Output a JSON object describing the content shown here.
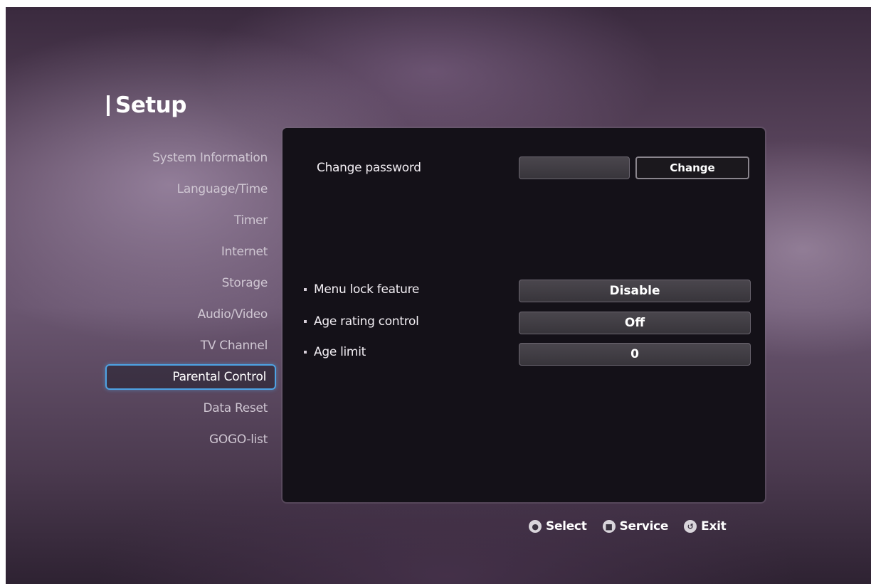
{
  "header": {
    "title": "Setup"
  },
  "sidebar": {
    "items": [
      {
        "label": "System Information",
        "selected": false
      },
      {
        "label": "Language/Time",
        "selected": false
      },
      {
        "label": "Timer",
        "selected": false
      },
      {
        "label": "Internet",
        "selected": false
      },
      {
        "label": "Storage",
        "selected": false
      },
      {
        "label": "Audio/Video",
        "selected": false
      },
      {
        "label": "TV Channel",
        "selected": false
      },
      {
        "label": "Parental Control",
        "selected": true
      },
      {
        "label": "Data Reset",
        "selected": false
      },
      {
        "label": "GOGO-list",
        "selected": false
      }
    ]
  },
  "panel": {
    "password": {
      "label": "Change password",
      "value": "",
      "button_label": "Change"
    },
    "settings": [
      {
        "label": "Menu lock feature",
        "value": "Disable"
      },
      {
        "label": "Age rating control",
        "value": "Off"
      },
      {
        "label": "Age limit",
        "value": "0"
      }
    ]
  },
  "footer": {
    "hints": [
      {
        "icon": "ok-button-icon",
        "label": "Select"
      },
      {
        "icon": "stop-button-icon",
        "label": "Service"
      },
      {
        "icon": "back-arrow-icon",
        "label": "Exit"
      }
    ]
  },
  "colors": {
    "selection_border": "#4ea3e4",
    "panel_background": "#141118",
    "field_background": "#413e45"
  }
}
